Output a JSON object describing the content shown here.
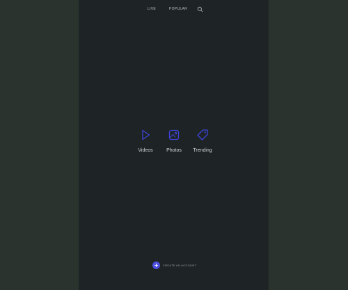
{
  "nav": {
    "live_label": "Live",
    "popular_label": "Popular",
    "search_icon": "search-icon"
  },
  "tiles": [
    {
      "label": "Videos",
      "icon": "play-icon"
    },
    {
      "label": "Photos",
      "icon": "image-icon"
    },
    {
      "label": "Trending",
      "icon": "tag-icon"
    }
  ],
  "footer": {
    "label": "Create an account",
    "icon": "plus-icon"
  },
  "colors": {
    "background": "#2a332e",
    "panel": "#1e2425",
    "accent": "#3d44d8",
    "text": "#d0d5d6"
  }
}
